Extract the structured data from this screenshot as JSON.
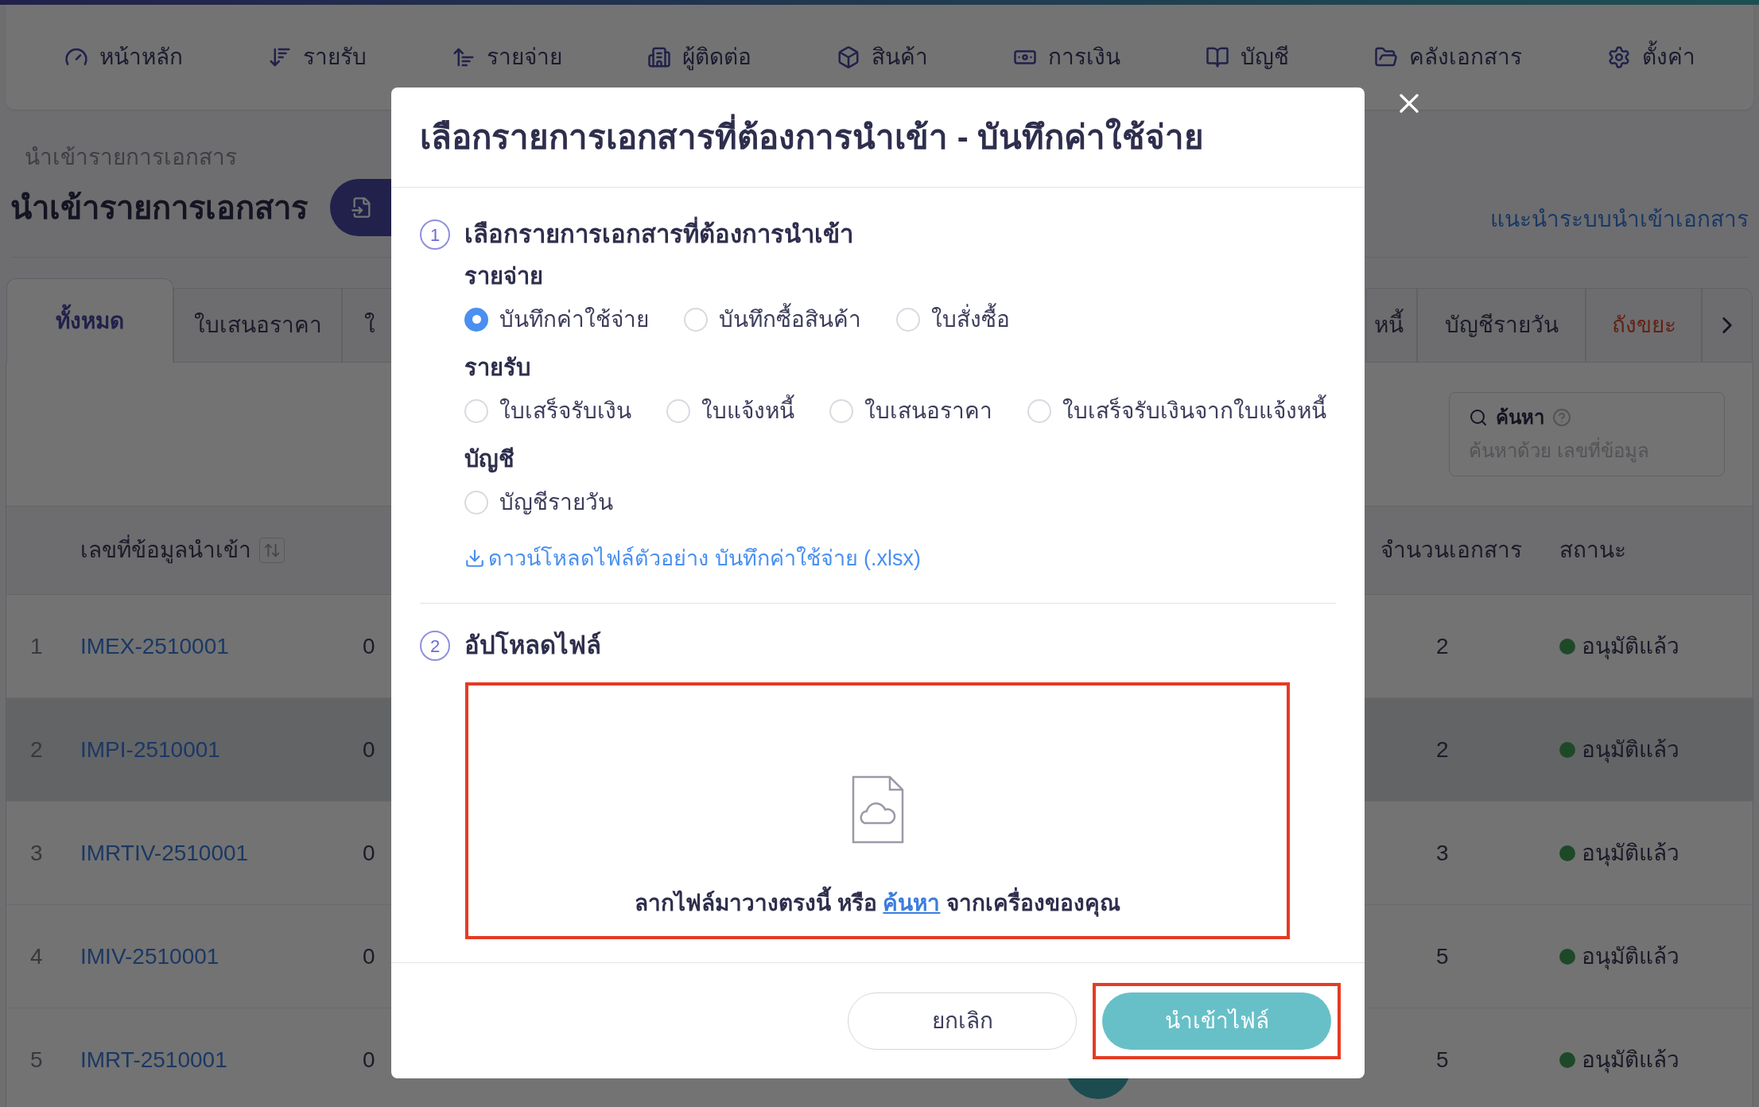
{
  "nav": [
    {
      "label": "หน้าหลัก"
    },
    {
      "label": "รายรับ"
    },
    {
      "label": "รายจ่าย"
    },
    {
      "label": "ผู้ติดต่อ"
    },
    {
      "label": "สินค้า"
    },
    {
      "label": "การเงิน"
    },
    {
      "label": "บัญชี"
    },
    {
      "label": "คลังเอกสาร"
    },
    {
      "label": "ตั้งค่า"
    }
  ],
  "page": {
    "breadcrumb": "นำเข้ารายการเอกสาร",
    "title": "นำเข้ารายการเอกสาร",
    "guide_link": "แนะนำระบบนำเข้าเอกสาร"
  },
  "tabs_left": [
    {
      "label": "ทั้งหมด",
      "selected": true,
      "kind": "normal"
    },
    {
      "label": "ใบเสนอราคา",
      "selected": false,
      "kind": "normal"
    },
    {
      "label": "ใ",
      "selected": false,
      "kind": "normal"
    }
  ],
  "tabs_right": [
    {
      "label": "หนี้",
      "selected": false,
      "kind": "normal"
    },
    {
      "label": "บัญชีรายวัน",
      "selected": false,
      "kind": "normal"
    },
    {
      "label": "ถังขยะ",
      "selected": false,
      "kind": "danger"
    }
  ],
  "search": {
    "label": "ค้นหา",
    "placeholder": "ค้นหาด้วย เลขที่ข้อมูล"
  },
  "table": {
    "columns": [
      "เลขที่ข้อมูลนำเข้า",
      "จำนวนเอกสาร",
      "สถานะ"
    ],
    "rows": [
      {
        "index": "1",
        "code": "IMEX-2510001",
        "column_3": "0",
        "count": "2",
        "status": "อนุมัติแล้ว",
        "highlighted": false
      },
      {
        "index": "2",
        "code": "IMPI-2510001",
        "column_3": "0",
        "count": "2",
        "status": "อนุมัติแล้ว",
        "highlighted": true
      },
      {
        "index": "3",
        "code": "IMRTIV-2510001",
        "column_3": "0",
        "count": "3",
        "status": "อนุมัติแล้ว",
        "highlighted": false
      },
      {
        "index": "4",
        "code": "IMIV-2510001",
        "column_3": "0",
        "count": "5",
        "status": "อนุมัติแล้ว",
        "highlighted": false
      },
      {
        "index": "5",
        "code": "IMRT-2510001",
        "column_3": "0",
        "count": "5",
        "status": "อนุมัติแล้ว",
        "highlighted": false
      }
    ]
  },
  "modal": {
    "title": "เลือกรายการเอกสารที่ต้องการนำเข้า - บันทึกค่าใช้จ่าย",
    "step1": {
      "number": "1",
      "title": "เลือกรายการเอกสารที่ต้องการนำเข้า",
      "groups": [
        {
          "label": "รายจ่าย",
          "options": [
            {
              "label": "บันทึกค่าใช้จ่าย",
              "selected": true
            },
            {
              "label": "บันทึกซื้อสินค้า",
              "selected": false
            },
            {
              "label": "ใบสั่งซื้อ",
              "selected": false
            }
          ]
        },
        {
          "label": "รายรับ",
          "options": [
            {
              "label": "ใบเสร็จรับเงิน",
              "selected": false
            },
            {
              "label": "ใบแจ้งหนี้",
              "selected": false
            },
            {
              "label": "ใบเสนอราคา",
              "selected": false
            },
            {
              "label": "ใบเสร็จรับเงินจากใบแจ้งหนี้",
              "selected": false
            }
          ]
        },
        {
          "label": "บัญชี",
          "options": [
            {
              "label": "บัญชีรายวัน",
              "selected": false
            }
          ]
        }
      ],
      "download_link": "ดาวน์โหลดไฟล์ตัวอย่าง บันทึกค่าใช้จ่าย (.xlsx)"
    },
    "step2": {
      "number": "2",
      "title": "อัปโหลดไฟล์",
      "dropzone": {
        "text_before": "ลากไฟล์มาวางตรงนี้ หรือ",
        "link": "ค้นหา",
        "text_after": "จากเครื่องของคุณ",
        "highlighted": true
      }
    },
    "cancel_button": {
      "label": "ยกเลิก"
    },
    "import_button": {
      "label": "นำเข้าไฟล์",
      "highlighted": true
    }
  }
}
